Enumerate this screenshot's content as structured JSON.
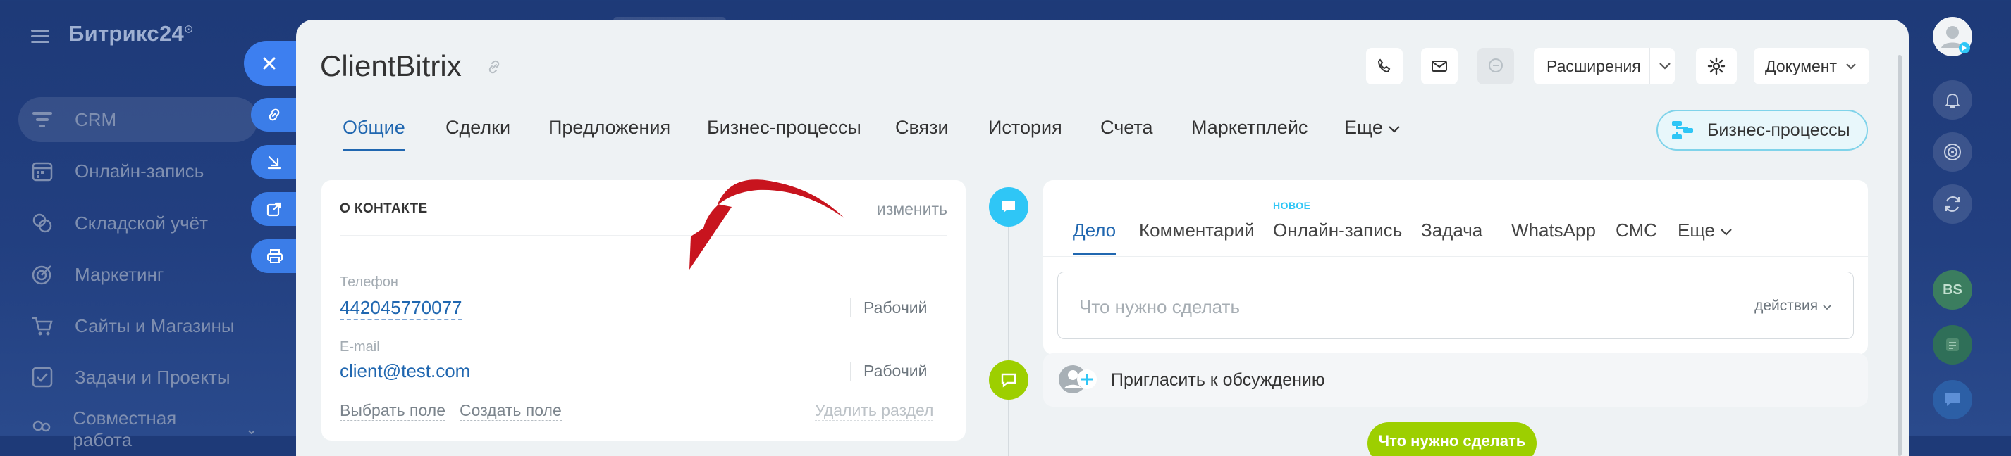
{
  "app": {
    "logo_text": "Битрикс24",
    "logo_mark": "⊙"
  },
  "sidebar": {
    "items": [
      {
        "label": "CRM",
        "icon": "funnel-icon",
        "active": true
      },
      {
        "label": "Онлайн-запись",
        "icon": "calendar-icon"
      },
      {
        "label": "Складской учёт",
        "icon": "boxes-icon"
      },
      {
        "label": "Маркетинг",
        "icon": "target-icon"
      },
      {
        "label": "Сайты и Магазины",
        "icon": "cart-icon"
      },
      {
        "label": "Задачи и Проекты",
        "icon": "checkbox-icon"
      },
      {
        "label": "Совместная работа",
        "icon": "team-icon"
      }
    ]
  },
  "entity": {
    "title": "ClientBitrix"
  },
  "header_buttons": {
    "extensions": "Расширения",
    "document": "Документ"
  },
  "tabs": [
    "Общие",
    "Сделки",
    "Предложения",
    "Бизнес-процессы",
    "Связи",
    "История",
    "Счета",
    "Маркетплейс",
    "Еще"
  ],
  "bp_button": "Бизнес-процессы",
  "contact": {
    "section_title": "О КОНТАКТЕ",
    "edit": "изменить",
    "phone_label": "Телефон",
    "phone_value": "442045770077",
    "phone_type": "Рабочий",
    "email_label": "E-mail",
    "email_value": "client@test.com",
    "email_type": "Рабочий",
    "select_field": "Выбрать поле",
    "create_field": "Создать поле",
    "delete_section": "Удалить раздел"
  },
  "activity": {
    "tabs": [
      "Дело",
      "Комментарий",
      "Онлайн-запись",
      "Задача",
      "WhatsApp",
      "СМС",
      "Еще"
    ],
    "new_badge": "НОВОЕ",
    "todo_placeholder": "Что нужно сделать",
    "actions": "действия",
    "invite": "Пригласить к обсуждению",
    "bottom_button": "Что нужно сделать"
  },
  "rail": {
    "avatar_initials": "BS"
  },
  "colors": {
    "accent_blue": "#2067b0",
    "fab_blue": "#3b7de8",
    "timeline_blue": "#2fc6f6",
    "timeline_green": "#9dcf00",
    "arrow_red": "#c8141e"
  }
}
